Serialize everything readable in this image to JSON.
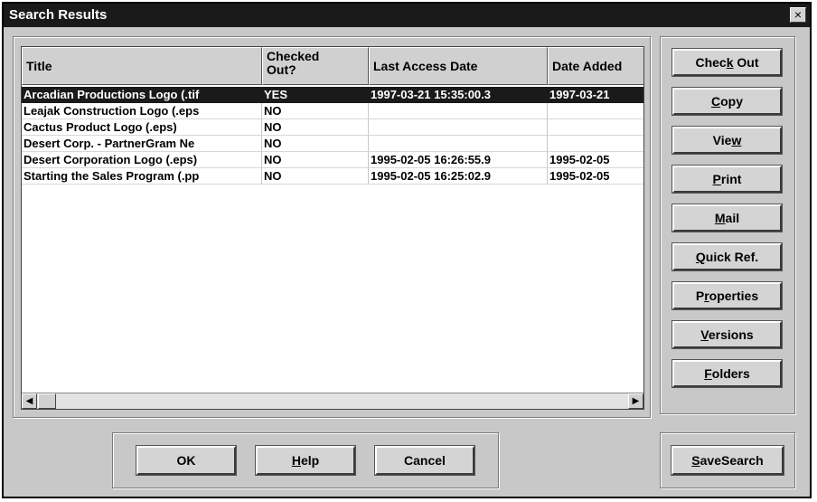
{
  "window": {
    "title": "Search Results",
    "close_glyph": "×"
  },
  "list": {
    "columns": {
      "title": "Title",
      "checked_out_line1": "Checked",
      "checked_out_line2": "Out?",
      "last_access": "Last Access Date",
      "date_added": "Date Added"
    },
    "rows": [
      {
        "title": "Arcadian Productions Logo (.tif",
        "checked": "YES",
        "access": "1997-03-21 15:35:00.3",
        "added": "1997-03-21"
      },
      {
        "title": "Leajak Construction Logo (.eps",
        "checked": "NO",
        "access": "",
        "added": ""
      },
      {
        "title": "Cactus Product Logo (.eps)",
        "checked": "NO",
        "access": "",
        "added": ""
      },
      {
        "title": "Desert Corp. - PartnerGram Ne",
        "checked": "NO",
        "access": "",
        "added": ""
      },
      {
        "title": "Desert Corporation Logo (.eps)",
        "checked": "NO",
        "access": "1995-02-05 16:26:55.9",
        "added": "1995-02-05"
      },
      {
        "title": "Starting the Sales Program (.pp",
        "checked": "NO",
        "access": "1995-02-05 16:25:02.9",
        "added": "1995-02-05"
      }
    ]
  },
  "side_buttons": {
    "check_out": {
      "pre": "Chec",
      "key": "k",
      "post": " Out"
    },
    "copy": {
      "pre": "",
      "key": "C",
      "post": "opy"
    },
    "view": {
      "pre": "Vie",
      "key": "w",
      "post": ""
    },
    "print": {
      "pre": "",
      "key": "P",
      "post": "rint"
    },
    "mail": {
      "pre": "",
      "key": "M",
      "post": "ail"
    },
    "quick_ref": {
      "pre": "",
      "key": "Q",
      "post": "uick Ref."
    },
    "properties": {
      "pre": "P",
      "key": "r",
      "post": "operties"
    },
    "versions": {
      "pre": "",
      "key": "V",
      "post": "ersions"
    },
    "folders": {
      "pre": "",
      "key": "F",
      "post": "olders"
    }
  },
  "bottom_buttons": {
    "ok": "OK",
    "help": {
      "key": "H",
      "post": "elp"
    },
    "cancel": "Cancel",
    "save_search": {
      "key": "S",
      "post": "aveSearch"
    }
  },
  "icons": {
    "scroll_left": "◀",
    "scroll_right": "▶"
  }
}
